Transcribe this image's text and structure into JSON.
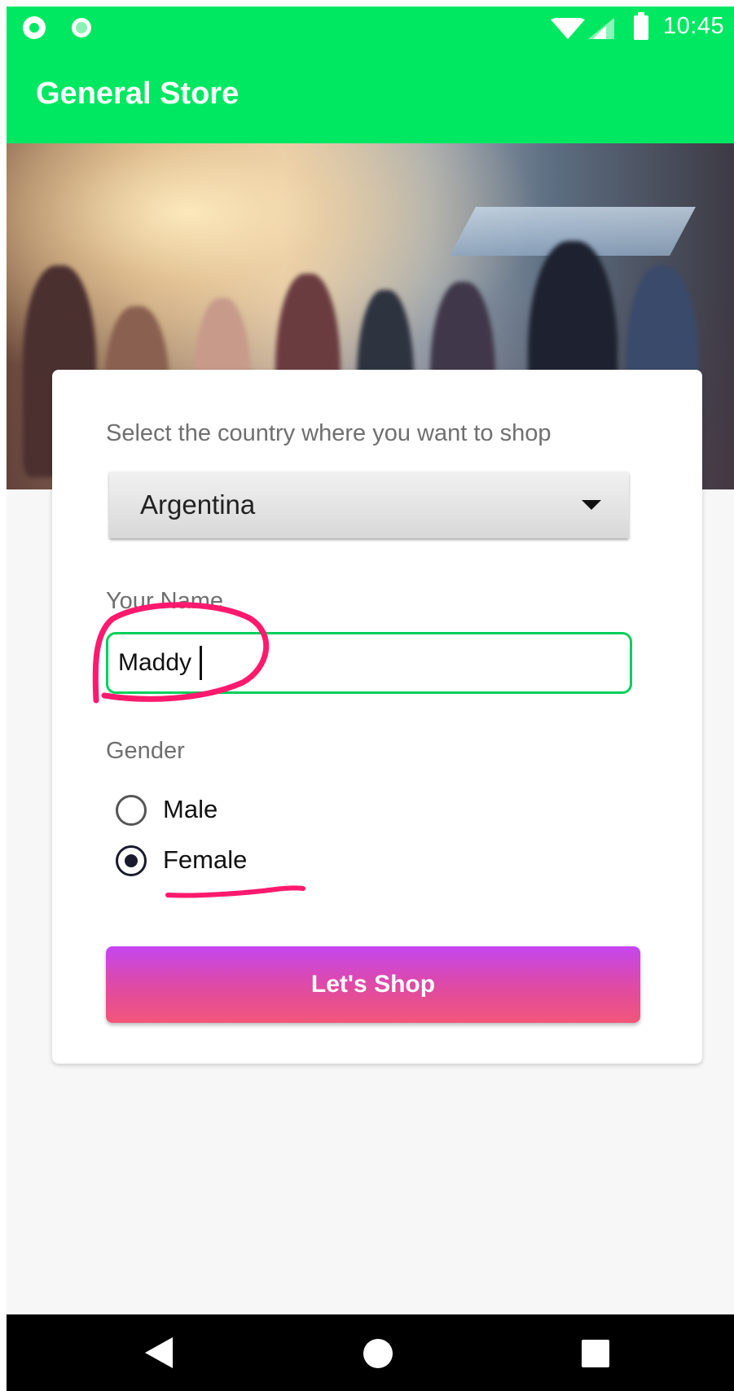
{
  "status_bar": {
    "time": "10:45",
    "icons": [
      "sync-icon",
      "notification-dot-icon",
      "wifi-icon",
      "signal-icon",
      "battery-icon"
    ]
  },
  "app_bar": {
    "title": "General Store",
    "color": "#00e862"
  },
  "form": {
    "country_label": "Select the country where you want to shop",
    "country_selected": "Argentina",
    "name_label": "Your Name",
    "name_value": "Maddy",
    "gender_label": "Gender",
    "gender_options": [
      {
        "label": "Male",
        "checked": false
      },
      {
        "label": "Female",
        "checked": true
      }
    ],
    "submit_label": "Let's  Shop"
  },
  "nav_bar": {
    "icons": [
      "back-icon",
      "home-icon",
      "recents-icon"
    ]
  },
  "colors": {
    "accent": "#00e862",
    "input_border": "#00d05a",
    "button_gradient_top": "#c446f0",
    "button_gradient_bottom": "#f2567a",
    "annotation": "#ff1a6e"
  }
}
